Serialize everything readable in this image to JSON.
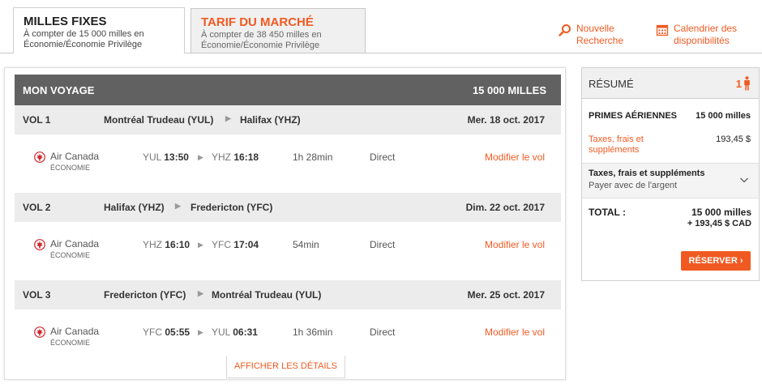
{
  "tabs": [
    {
      "title": "MILLES FIXES",
      "line1": "À compter de  15 000 milles en",
      "line2": "Économie/Économie Privilège"
    },
    {
      "title": "TARIF DU MARCHÉ",
      "line1": "À compter de  38 450 milles en",
      "line2": "Économie/Économie Privilège"
    }
  ],
  "links": {
    "new_search_1": "Nouvelle",
    "new_search_2": "Recherche",
    "calendar_1": "Calendrier des",
    "calendar_2": "disponibilités"
  },
  "trip": {
    "title": "MON VOYAGE",
    "total": "15 000 MILLES"
  },
  "flights": [
    {
      "label": "VOL 1",
      "from": "Montréal Trudeau (YUL)",
      "to": "Halifax (YHZ)",
      "date": "Mer. 18 oct. 2017",
      "airline": "Air Canada",
      "cabin": "ÉCONOMIE",
      "dep_code": "YUL",
      "dep_time": "13:50",
      "arr_code": "YHZ",
      "arr_time": "16:18",
      "duration": "1h 28min",
      "stops": "Direct",
      "modify": "Modifier le vol"
    },
    {
      "label": "VOL 2",
      "from": "Halifax (YHZ)",
      "to": "Fredericton (YFC)",
      "date": "Dim. 22 oct. 2017",
      "airline": "Air Canada",
      "cabin": "ÉCONOMIE",
      "dep_code": "YHZ",
      "dep_time": "16:10",
      "arr_code": "YFC",
      "arr_time": "17:04",
      "duration": "54min",
      "stops": "Direct",
      "modify": "Modifier le vol"
    },
    {
      "label": "VOL 3",
      "from": "Fredericton (YFC)",
      "to": "Montréal Trudeau (YUL)",
      "date": "Mer. 25 oct. 2017",
      "airline": "Air Canada",
      "cabin": "ÉCONOMIE",
      "dep_code": "YFC",
      "dep_time": "05:55",
      "arr_code": "YUL",
      "arr_time": "06:31",
      "duration": "1h 36min",
      "stops": "Direct",
      "modify": "Modifier le vol"
    }
  ],
  "details_button": "AFFICHER LES DÉTAILS",
  "summary": {
    "title": "RÉSUMÉ",
    "passengers": "1",
    "primes_label": "PRIMES AÉRIENNES",
    "primes_value": "15 000 milles",
    "taxes_label_1": "Taxes, frais et",
    "taxes_label_2": "suppléments",
    "taxes_value": "193,45 $",
    "pay_title": "Taxes, frais et suppléments",
    "pay_sub": "Payer avec de l'argent",
    "total_label": "TOTAL :",
    "total_miles": "15 000  milles",
    "total_cash": "+ 193,45 $ CAD",
    "reserve_label": "RÉSERVER"
  },
  "colors": {
    "accent": "#f05a22",
    "header": "#616161",
    "row": "#ececec"
  }
}
